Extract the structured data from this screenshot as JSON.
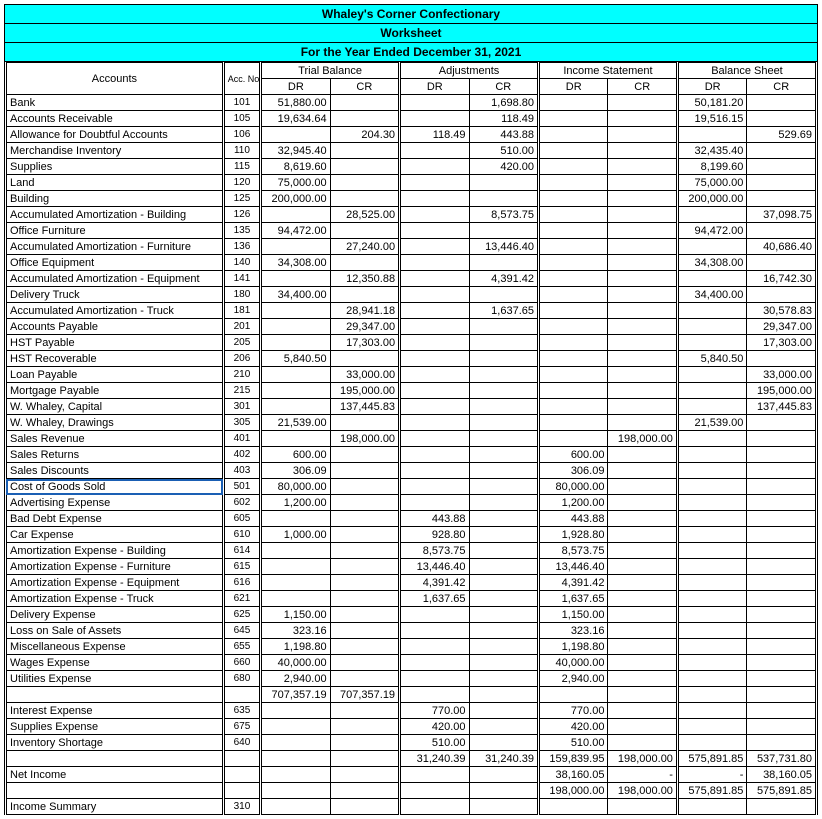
{
  "header": {
    "title": "Whaley's Corner Confectionary",
    "subtitle": "Worksheet",
    "period": "For the Year Ended December 31, 2021"
  },
  "column_groups": {
    "accounts": "Accounts",
    "acc_no": "Acc. No.",
    "trial_balance": "Trial Balance",
    "adjustments": "Adjustments",
    "income_statement": "Income Statement",
    "balance_sheet": "Balance Sheet",
    "dr": "DR",
    "cr": "CR"
  },
  "rows": [
    {
      "acct": "Bank",
      "no": "101",
      "tb_dr": "51,880.00",
      "tb_cr": "",
      "adj_dr": "",
      "adj_cr": "1,698.80",
      "is_dr": "",
      "is_cr": "",
      "bs_dr": "50,181.20",
      "bs_cr": ""
    },
    {
      "acct": "Accounts Receivable",
      "no": "105",
      "tb_dr": "19,634.64",
      "tb_cr": "",
      "adj_dr": "",
      "adj_cr": "118.49",
      "is_dr": "",
      "is_cr": "",
      "bs_dr": "19,516.15",
      "bs_cr": ""
    },
    {
      "acct": "Allowance for Doubtful Accounts",
      "no": "106",
      "tb_dr": "",
      "tb_cr": "204.30",
      "adj_dr": "118.49",
      "adj_cr": "443.88",
      "is_dr": "",
      "is_cr": "",
      "bs_dr": "",
      "bs_cr": "529.69"
    },
    {
      "acct": "Merchandise Inventory",
      "no": "110",
      "tb_dr": "32,945.40",
      "tb_cr": "",
      "adj_dr": "",
      "adj_cr": "510.00",
      "is_dr": "",
      "is_cr": "",
      "bs_dr": "32,435.40",
      "bs_cr": ""
    },
    {
      "acct": "Supplies",
      "no": "115",
      "tb_dr": "8,619.60",
      "tb_cr": "",
      "adj_dr": "",
      "adj_cr": "420.00",
      "is_dr": "",
      "is_cr": "",
      "bs_dr": "8,199.60",
      "bs_cr": ""
    },
    {
      "acct": "Land",
      "no": "120",
      "tb_dr": "75,000.00",
      "tb_cr": "",
      "adj_dr": "",
      "adj_cr": "",
      "is_dr": "",
      "is_cr": "",
      "bs_dr": "75,000.00",
      "bs_cr": ""
    },
    {
      "acct": "Building",
      "no": "125",
      "tb_dr": "200,000.00",
      "tb_cr": "",
      "adj_dr": "",
      "adj_cr": "",
      "is_dr": "",
      "is_cr": "",
      "bs_dr": "200,000.00",
      "bs_cr": ""
    },
    {
      "acct": "Accumulated Amortization - Building",
      "no": "126",
      "tb_dr": "",
      "tb_cr": "28,525.00",
      "adj_dr": "",
      "adj_cr": "8,573.75",
      "is_dr": "",
      "is_cr": "",
      "bs_dr": "",
      "bs_cr": "37,098.75"
    },
    {
      "acct": "Office Furniture",
      "no": "135",
      "tb_dr": "94,472.00",
      "tb_cr": "",
      "adj_dr": "",
      "adj_cr": "",
      "is_dr": "",
      "is_cr": "",
      "bs_dr": "94,472.00",
      "bs_cr": ""
    },
    {
      "acct": "Accumulated Amortization - Furniture",
      "no": "136",
      "tb_dr": "",
      "tb_cr": "27,240.00",
      "adj_dr": "",
      "adj_cr": "13,446.40",
      "is_dr": "",
      "is_cr": "",
      "bs_dr": "",
      "bs_cr": "40,686.40"
    },
    {
      "acct": "Office Equipment",
      "no": "140",
      "tb_dr": "34,308.00",
      "tb_cr": "",
      "adj_dr": "",
      "adj_cr": "",
      "is_dr": "",
      "is_cr": "",
      "bs_dr": "34,308.00",
      "bs_cr": ""
    },
    {
      "acct": "Accumulated Amortization - Equipment",
      "no": "141",
      "tb_dr": "",
      "tb_cr": "12,350.88",
      "adj_dr": "",
      "adj_cr": "4,391.42",
      "is_dr": "",
      "is_cr": "",
      "bs_dr": "",
      "bs_cr": "16,742.30"
    },
    {
      "acct": "Delivery Truck",
      "no": "180",
      "tb_dr": "34,400.00",
      "tb_cr": "",
      "adj_dr": "",
      "adj_cr": "",
      "is_dr": "",
      "is_cr": "",
      "bs_dr": "34,400.00",
      "bs_cr": ""
    },
    {
      "acct": "Accumulated Amortization  - Truck",
      "no": "181",
      "tb_dr": "",
      "tb_cr": "28,941.18",
      "adj_dr": "",
      "adj_cr": "1,637.65",
      "is_dr": "",
      "is_cr": "",
      "bs_dr": "",
      "bs_cr": "30,578.83"
    },
    {
      "acct": "Accounts Payable",
      "no": "201",
      "tb_dr": "",
      "tb_cr": "29,347.00",
      "adj_dr": "",
      "adj_cr": "",
      "is_dr": "",
      "is_cr": "",
      "bs_dr": "",
      "bs_cr": "29,347.00"
    },
    {
      "acct": "HST Payable",
      "no": "205",
      "tb_dr": "",
      "tb_cr": "17,303.00",
      "adj_dr": "",
      "adj_cr": "",
      "is_dr": "",
      "is_cr": "",
      "bs_dr": "",
      "bs_cr": "17,303.00"
    },
    {
      "acct": "HST Recoverable",
      "no": "206",
      "tb_dr": "5,840.50",
      "tb_cr": "",
      "adj_dr": "",
      "adj_cr": "",
      "is_dr": "",
      "is_cr": "",
      "bs_dr": "5,840.50",
      "bs_cr": ""
    },
    {
      "acct": "Loan Payable",
      "no": "210",
      "tb_dr": "",
      "tb_cr": "33,000.00",
      "adj_dr": "",
      "adj_cr": "",
      "is_dr": "",
      "is_cr": "",
      "bs_dr": "",
      "bs_cr": "33,000.00"
    },
    {
      "acct": "Mortgage Payable",
      "no": "215",
      "tb_dr": "",
      "tb_cr": "195,000.00",
      "adj_dr": "",
      "adj_cr": "",
      "is_dr": "",
      "is_cr": "",
      "bs_dr": "",
      "bs_cr": "195,000.00"
    },
    {
      "acct": "W. Whaley, Capital",
      "no": "301",
      "tb_dr": "",
      "tb_cr": "137,445.83",
      "adj_dr": "",
      "adj_cr": "",
      "is_dr": "",
      "is_cr": "",
      "bs_dr": "",
      "bs_cr": "137,445.83"
    },
    {
      "acct": "W. Whaley, Drawings",
      "no": "305",
      "tb_dr": "21,539.00",
      "tb_cr": "",
      "adj_dr": "",
      "adj_cr": "",
      "is_dr": "",
      "is_cr": "",
      "bs_dr": "21,539.00",
      "bs_cr": ""
    },
    {
      "acct": "Sales Revenue",
      "no": "401",
      "tb_dr": "",
      "tb_cr": "198,000.00",
      "adj_dr": "",
      "adj_cr": "",
      "is_dr": "",
      "is_cr": "198,000.00",
      "bs_dr": "",
      "bs_cr": ""
    },
    {
      "acct": "Sales Returns",
      "no": "402",
      "tb_dr": "600.00",
      "tb_cr": "",
      "adj_dr": "",
      "adj_cr": "",
      "is_dr": "600.00",
      "is_cr": "",
      "bs_dr": "",
      "bs_cr": ""
    },
    {
      "acct": "Sales Discounts",
      "no": "403",
      "tb_dr": "306.09",
      "tb_cr": "",
      "adj_dr": "",
      "adj_cr": "",
      "is_dr": "306.09",
      "is_cr": "",
      "bs_dr": "",
      "bs_cr": ""
    },
    {
      "acct": "Cost of Goods Sold",
      "no": "501",
      "tb_dr": "80,000.00",
      "tb_cr": "",
      "adj_dr": "",
      "adj_cr": "",
      "is_dr": "80,000.00",
      "is_cr": "",
      "bs_dr": "",
      "bs_cr": "",
      "selected": true
    },
    {
      "acct": "Advertising Expense",
      "no": "602",
      "tb_dr": "1,200.00",
      "tb_cr": "",
      "adj_dr": "",
      "adj_cr": "",
      "is_dr": "1,200.00",
      "is_cr": "",
      "bs_dr": "",
      "bs_cr": ""
    },
    {
      "acct": "Bad Debt Expense",
      "no": "605",
      "tb_dr": "",
      "tb_cr": "",
      "adj_dr": "443.88",
      "adj_cr": "",
      "is_dr": "443.88",
      "is_cr": "",
      "bs_dr": "",
      "bs_cr": ""
    },
    {
      "acct": "Car Expense",
      "no": "610",
      "tb_dr": "1,000.00",
      "tb_cr": "",
      "adj_dr": "928.80",
      "adj_cr": "",
      "is_dr": "1,928.80",
      "is_cr": "",
      "bs_dr": "",
      "bs_cr": ""
    },
    {
      "acct": "Amortization Expense - Building",
      "no": "614",
      "tb_dr": "",
      "tb_cr": "",
      "adj_dr": "8,573.75",
      "adj_cr": "",
      "is_dr": "8,573.75",
      "is_cr": "",
      "bs_dr": "",
      "bs_cr": ""
    },
    {
      "acct": "Amortization Expense - Furniture",
      "no": "615",
      "tb_dr": "",
      "tb_cr": "",
      "adj_dr": "13,446.40",
      "adj_cr": "",
      "is_dr": "13,446.40",
      "is_cr": "",
      "bs_dr": "",
      "bs_cr": ""
    },
    {
      "acct": "Amortization Expense - Equipment",
      "no": "616",
      "tb_dr": "",
      "tb_cr": "",
      "adj_dr": "4,391.42",
      "adj_cr": "",
      "is_dr": "4,391.42",
      "is_cr": "",
      "bs_dr": "",
      "bs_cr": ""
    },
    {
      "acct": "Amortization Expense - Truck",
      "no": "621",
      "tb_dr": "",
      "tb_cr": "",
      "adj_dr": "1,637.65",
      "adj_cr": "",
      "is_dr": "1,637.65",
      "is_cr": "",
      "bs_dr": "",
      "bs_cr": ""
    },
    {
      "acct": "Delivery Expense",
      "no": "625",
      "tb_dr": "1,150.00",
      "tb_cr": "",
      "adj_dr": "",
      "adj_cr": "",
      "is_dr": "1,150.00",
      "is_cr": "",
      "bs_dr": "",
      "bs_cr": ""
    },
    {
      "acct": "Loss on Sale of Assets",
      "no": "645",
      "tb_dr": "323.16",
      "tb_cr": "",
      "adj_dr": "",
      "adj_cr": "",
      "is_dr": "323.16",
      "is_cr": "",
      "bs_dr": "",
      "bs_cr": ""
    },
    {
      "acct": "Miscellaneous Expense",
      "no": "655",
      "tb_dr": "1,198.80",
      "tb_cr": "",
      "adj_dr": "",
      "adj_cr": "",
      "is_dr": "1,198.80",
      "is_cr": "",
      "bs_dr": "",
      "bs_cr": ""
    },
    {
      "acct": "Wages Expense",
      "no": "660",
      "tb_dr": "40,000.00",
      "tb_cr": "",
      "adj_dr": "",
      "adj_cr": "",
      "is_dr": "40,000.00",
      "is_cr": "",
      "bs_dr": "",
      "bs_cr": ""
    },
    {
      "acct": "Utilities Expense",
      "no": "680",
      "tb_dr": "2,940.00",
      "tb_cr": "",
      "adj_dr": "",
      "adj_cr": "",
      "is_dr": "2,940.00",
      "is_cr": "",
      "bs_dr": "",
      "bs_cr": ""
    },
    {
      "acct": "",
      "no": "",
      "tb_dr": "707,357.19",
      "tb_cr": "707,357.19",
      "adj_dr": "",
      "adj_cr": "",
      "is_dr": "",
      "is_cr": "",
      "bs_dr": "",
      "bs_cr": ""
    },
    {
      "acct": "Interest Expense",
      "no": "635",
      "tb_dr": "",
      "tb_cr": "",
      "adj_dr": "770.00",
      "adj_cr": "",
      "is_dr": "770.00",
      "is_cr": "",
      "bs_dr": "",
      "bs_cr": ""
    },
    {
      "acct": "Supplies Expense",
      "no": "675",
      "tb_dr": "",
      "tb_cr": "",
      "adj_dr": "420.00",
      "adj_cr": "",
      "is_dr": "420.00",
      "is_cr": "",
      "bs_dr": "",
      "bs_cr": ""
    },
    {
      "acct": "Inventory Shortage",
      "no": "640",
      "tb_dr": "",
      "tb_cr": "",
      "adj_dr": "510.00",
      "adj_cr": "",
      "is_dr": "510.00",
      "is_cr": "",
      "bs_dr": "",
      "bs_cr": ""
    },
    {
      "acct": "",
      "no": "",
      "tb_dr": "",
      "tb_cr": "",
      "adj_dr": "31,240.39",
      "adj_cr": "31,240.39",
      "is_dr": "159,839.95",
      "is_cr": "198,000.00",
      "bs_dr": "575,891.85",
      "bs_cr": "537,731.80"
    },
    {
      "acct": "Net Income",
      "no": "",
      "tb_dr": "",
      "tb_cr": "",
      "adj_dr": "",
      "adj_cr": "",
      "is_dr": "38,160.05",
      "is_cr": "-",
      "bs_dr": "-",
      "bs_cr": "38,160.05"
    },
    {
      "acct": "",
      "no": "",
      "tb_dr": "",
      "tb_cr": "",
      "adj_dr": "",
      "adj_cr": "",
      "is_dr": "198,000.00",
      "is_cr": "198,000.00",
      "bs_dr": "575,891.85",
      "bs_cr": "575,891.85"
    },
    {
      "acct": "Income Summary",
      "no": "310",
      "tb_dr": "",
      "tb_cr": "",
      "adj_dr": "",
      "adj_cr": "",
      "is_dr": "",
      "is_cr": "",
      "bs_dr": "",
      "bs_cr": ""
    }
  ]
}
